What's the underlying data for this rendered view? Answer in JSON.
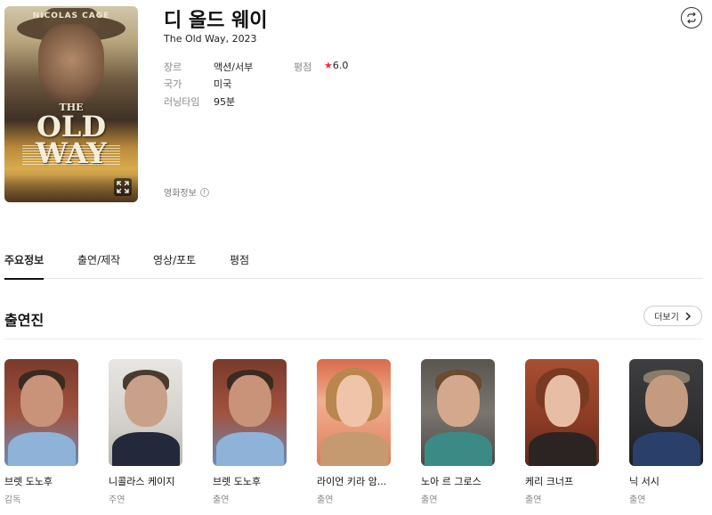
{
  "poster": {
    "actor_text": "NICOLAS CAGE",
    "title_the": "THE",
    "title_main": "OLD WAY",
    "expand_icon": "expand-icon"
  },
  "movie": {
    "title": "디 올드 웨이",
    "subtitle": "The Old Way, 2023",
    "genre_label": "장르",
    "genre_value": "액션/서부",
    "rating_label": "평점",
    "rating_star": "★",
    "rating_value": "6.0",
    "country_label": "국가",
    "country_value": "미국",
    "runtime_label": "러닝타임",
    "runtime_value": "95분",
    "info_link": "영화정보",
    "info_icon": "!"
  },
  "tabs": [
    {
      "label": "주요정보"
    },
    {
      "label": "출연/제작"
    },
    {
      "label": "영상/포토"
    },
    {
      "label": "평점"
    }
  ],
  "cast_section": {
    "title": "출연진",
    "more_label": "더보기",
    "more_icon": "›"
  },
  "cast": [
    {
      "name": "브렛 도노후",
      "role": "감독"
    },
    {
      "name": "니콜라스 케이지",
      "role": "주연"
    },
    {
      "name": "브렛 도노후",
      "role": "출연"
    },
    {
      "name": "라이언 키라 암...",
      "role": "출연"
    },
    {
      "name": "노아 르 그로스",
      "role": "출연"
    },
    {
      "name": "케리 크너프",
      "role": "출연"
    },
    {
      "name": "닉 서시",
      "role": "출연"
    }
  ],
  "colors": {
    "accent_star": "#e8323c",
    "tab_active": "#111111"
  }
}
